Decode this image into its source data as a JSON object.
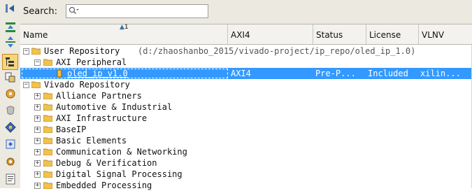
{
  "search": {
    "label": "Search:",
    "placeholder": "Q▾"
  },
  "sort": {
    "index": "1"
  },
  "columns": [
    "Name",
    "AXI4",
    "Status",
    "License",
    "VLNV"
  ],
  "tree": {
    "user_repo": {
      "label": "User Repository",
      "path": "(d:/zhaoshanbo_2015/vivado-project/ip_repo/oled_ip_1.0)"
    },
    "axi_peripheral": {
      "label": "AXI Peripheral"
    },
    "selected_row": {
      "name": "oled_ip_v1.0",
      "axi4": "AXI4",
      "status": "Pre-P...",
      "license": "Included",
      "vlnv": "xilin..."
    },
    "vivado_repo": {
      "label": "Vivado Repository"
    },
    "categories": [
      "Alliance Partners",
      "Automotive & Industrial",
      "AXI Infrastructure",
      "BaseIP",
      "Basic Elements",
      "Communication & Networking",
      "Debug & Verification",
      "Digital Signal Processing",
      "Embedded Processing"
    ]
  },
  "colors": {
    "selection": "#3399ff",
    "toolbar_bg": "#ece9e0",
    "folder": "#f2c24e"
  },
  "icons": [
    "collapse-all-icon",
    "expand-all-icon",
    "hierarchy-icon",
    "flat-view-icon",
    "compatibility-icon",
    "dependency-icon",
    "ip-details-icon",
    "customize-ip-icon",
    "settings-icon",
    "ip-info-icon"
  ]
}
